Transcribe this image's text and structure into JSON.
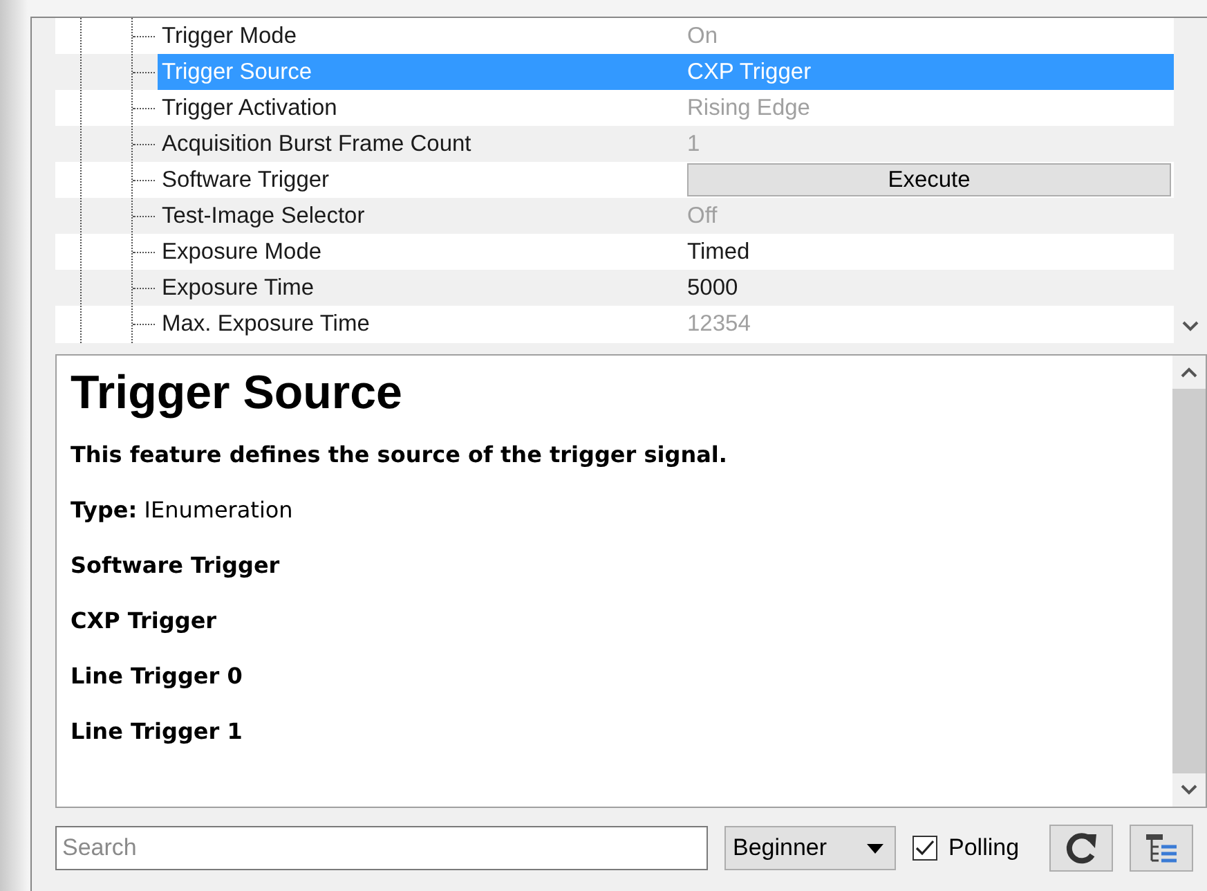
{
  "features": [
    {
      "label": "Trigger Mode",
      "kind": "value",
      "value": "On",
      "disabled": true,
      "selected": false
    },
    {
      "label": "Trigger Source",
      "kind": "value",
      "value": "CXP Trigger",
      "disabled": false,
      "selected": true
    },
    {
      "label": "Trigger Activation",
      "kind": "value",
      "value": "Rising Edge",
      "disabled": true,
      "selected": false
    },
    {
      "label": "Acquisition Burst Frame Count",
      "kind": "value",
      "value": "1",
      "disabled": true,
      "selected": false
    },
    {
      "label": "Software Trigger",
      "kind": "command",
      "value": "Execute",
      "disabled": false,
      "selected": false
    },
    {
      "label": "Test-Image Selector",
      "kind": "value",
      "value": "Off",
      "disabled": true,
      "selected": false
    },
    {
      "label": "Exposure Mode",
      "kind": "value",
      "value": "Timed",
      "disabled": false,
      "selected": false
    },
    {
      "label": "Exposure Time",
      "kind": "value",
      "value": "5000",
      "disabled": false,
      "selected": false
    },
    {
      "label": "Max. Exposure Time",
      "kind": "value",
      "value": "12354",
      "disabled": true,
      "selected": false
    }
  ],
  "description": {
    "title": "Trigger Source",
    "summary": "This feature defines the source of the trigger signal.",
    "type_line": "**Type:** IEnumeration",
    "entries": [
      "Software Trigger",
      "CXP Trigger",
      "Line Trigger 0",
      "Line Trigger 1"
    ]
  },
  "toolbar": {
    "search": {
      "placeholder": "Search"
    },
    "visibility": "Beginner",
    "polling": {
      "label": "Polling",
      "checked": true
    }
  }
}
